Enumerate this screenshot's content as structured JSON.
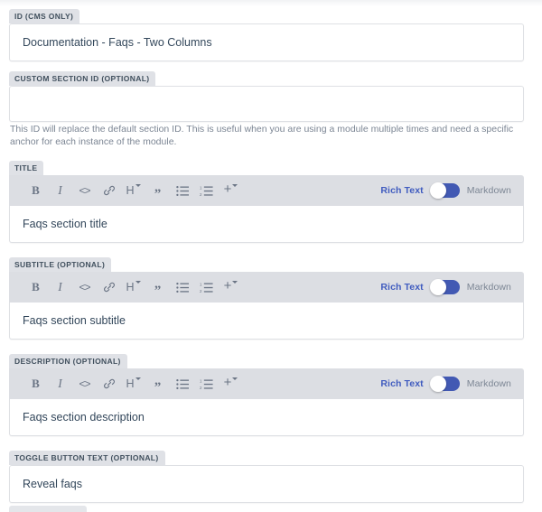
{
  "form": {
    "fields": [
      {
        "id": "id-cms-only",
        "label": "ID (CMS ONLY)",
        "type": "text",
        "value": "Documentation - Faqs - Two Columns",
        "placeholder": ""
      },
      {
        "id": "custom-section-id",
        "label": "CUSTOM SECTION ID (OPTIONAL)",
        "type": "textarea",
        "value": "",
        "placeholder": "",
        "helper_text": "This ID will replace the default section ID. This is useful when you are using a module multiple times and need a specific anchor for each instance of the module."
      },
      {
        "id": "title",
        "label": "TITLE",
        "type": "richtext",
        "value": "Faqs section title",
        "placeholder": ""
      },
      {
        "id": "subtitle",
        "label": "SUBTITLE (OPTIONAL)",
        "type": "richtext",
        "value": "Faqs section subtitle",
        "placeholder": ""
      },
      {
        "id": "description",
        "label": "DESCRIPTION (OPTIONAL)",
        "type": "richtext",
        "value": "Faqs section description",
        "placeholder": ""
      },
      {
        "id": "toggle-button-text",
        "label": "TOGGLE BUTTON TEXT (OPTIONAL)",
        "type": "text",
        "value": "Reveal faqs",
        "placeholder": ""
      }
    ]
  },
  "editor_toolbar": {
    "tools": [
      {
        "name": "bold-icon",
        "glyph": "B",
        "title": "Bold"
      },
      {
        "name": "italic-icon",
        "glyph": "I",
        "title": "Italic"
      },
      {
        "name": "source-code-icon",
        "glyph": "<>",
        "title": "Source code"
      },
      {
        "name": "link-icon",
        "glyph": "link",
        "title": "Insert link"
      },
      {
        "name": "heading-icon",
        "glyph": "H",
        "title": "Heading",
        "has_caret": true
      },
      {
        "name": "blockquote-icon",
        "glyph": "”",
        "title": "Blockquote"
      },
      {
        "name": "bulleted-list-icon",
        "glyph": "list",
        "title": "Bulleted list"
      },
      {
        "name": "numbered-list-icon",
        "glyph": "ordered-list",
        "title": "Numbered list"
      },
      {
        "name": "insert-more-icon",
        "glyph": "+",
        "title": "Insert",
        "has_caret": true
      }
    ],
    "mode_toggle": {
      "left_label": "Rich Text",
      "right_label": "Markdown",
      "active": "Rich Text"
    }
  },
  "colors": {
    "accent_blue": "#4259b3",
    "active_label": "#3f5bbf",
    "label_tab_bg": "#dfe1e6",
    "toolbar_bg": "#dcdee3",
    "input_text": "#33475b",
    "helper_text": "#7c8694",
    "border": "#dee0e4"
  }
}
